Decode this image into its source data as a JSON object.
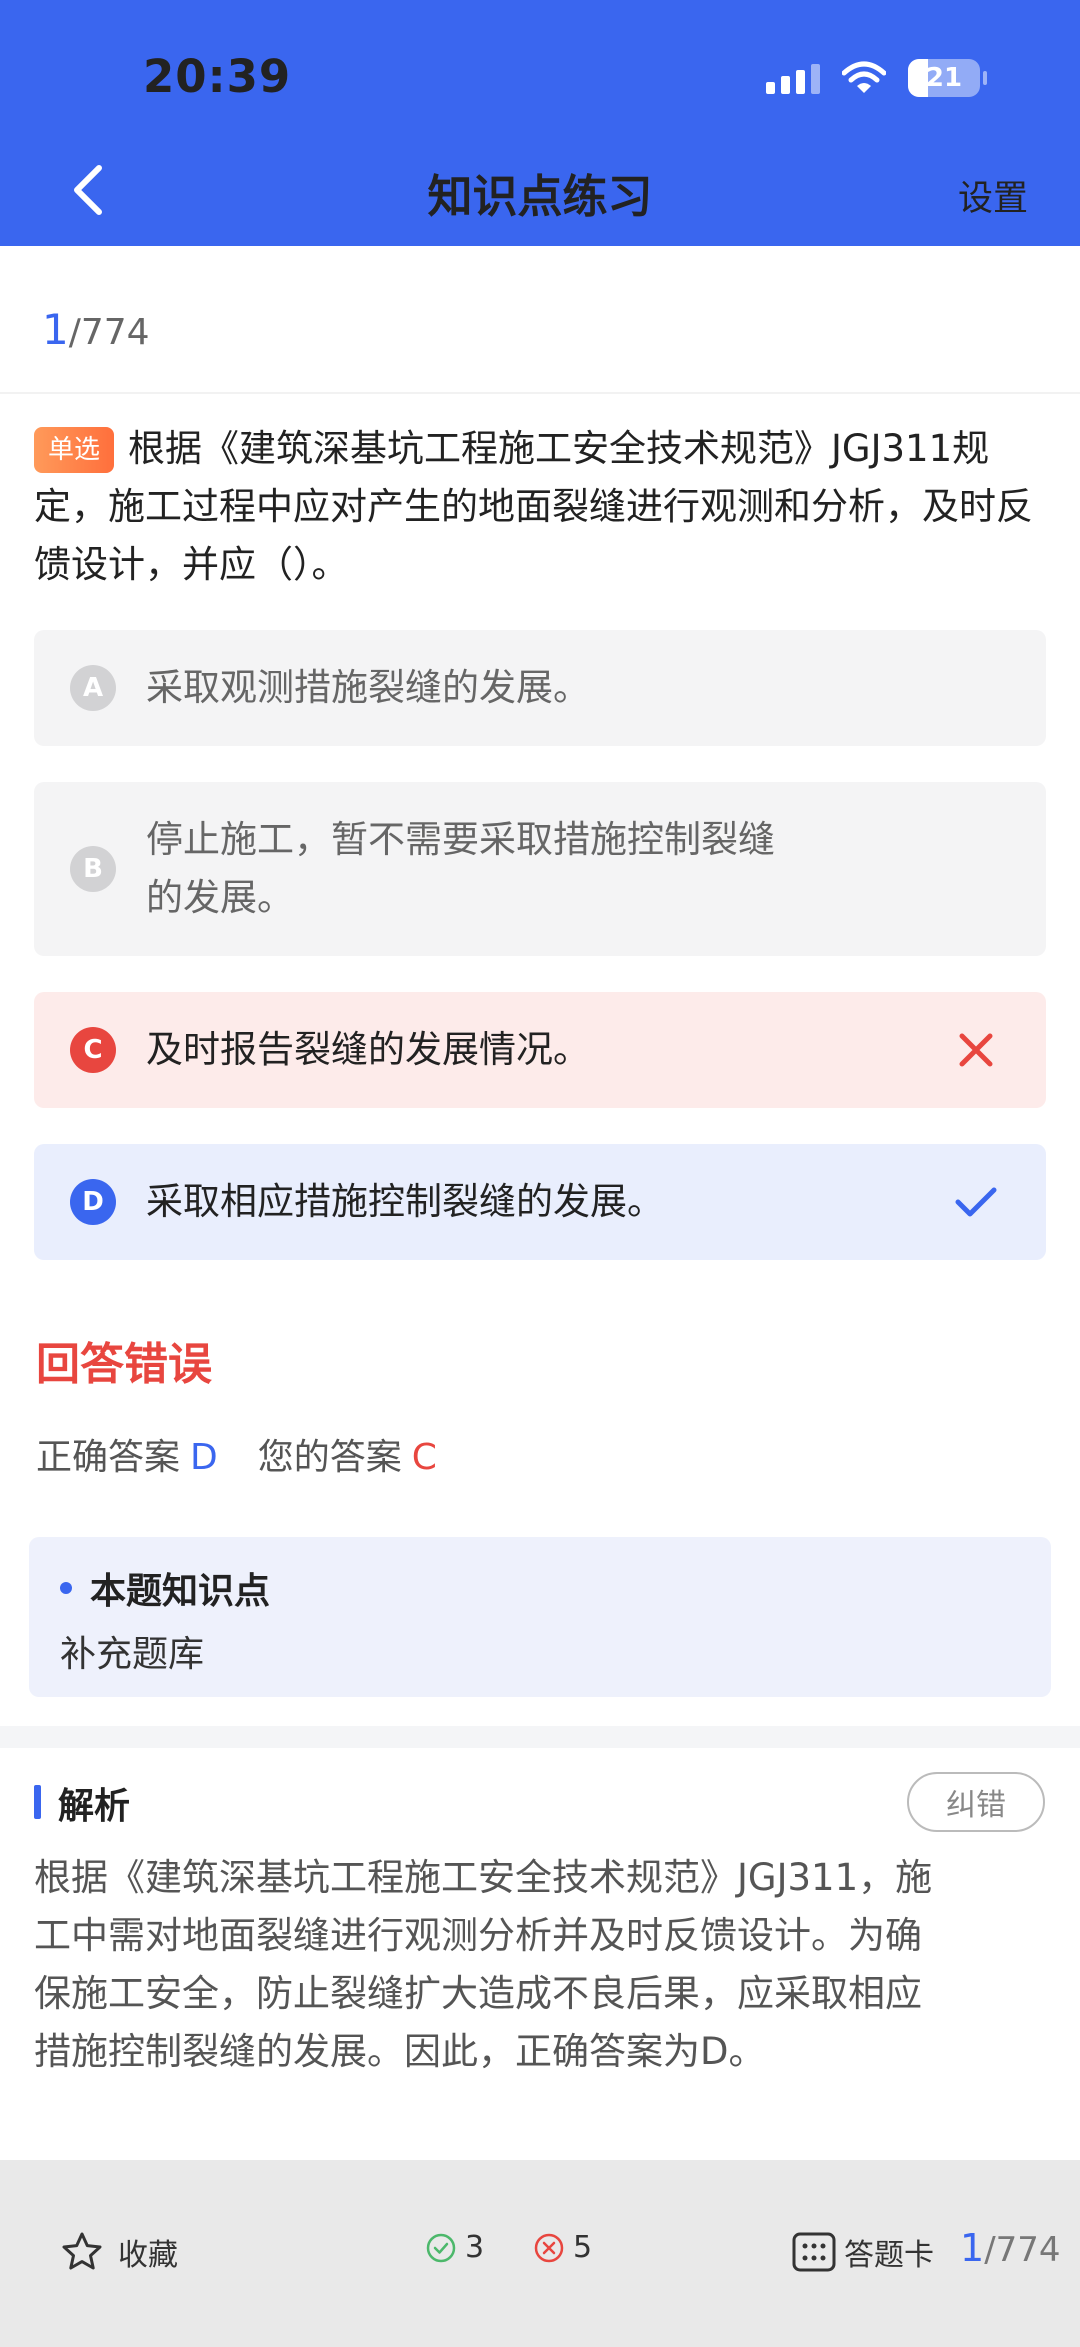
{
  "status_bar": {
    "time": "20:39",
    "battery": "21"
  },
  "nav": {
    "title": "知识点练习",
    "settings_label": "设置"
  },
  "progress": {
    "current": "1",
    "total": "/774"
  },
  "question": {
    "type_tag": "单选",
    "text": "根据《建筑深基坑工程施工安全技术规范》JGJ311规定，施工过程中应对产生的地面裂缝进行观测和分析，及时反馈设计，并应（）。"
  },
  "options": [
    {
      "letter": "A",
      "text": "采取观测措施裂缝的发展。",
      "state": "normal"
    },
    {
      "letter": "B",
      "line1": "停止施工，暂不需要采取措施控制裂缝",
      "line2": "的发展。",
      "state": "normal"
    },
    {
      "letter": "C",
      "text": "及时报告裂缝的发展情况。",
      "state": "wrong"
    },
    {
      "letter": "D",
      "text": "采取相应措施控制裂缝的发展。",
      "state": "correct"
    }
  ],
  "result": {
    "title": "回答错误",
    "correct_label": "正确答案",
    "correct_value": "D",
    "your_label": "您的答案",
    "your_value": "C"
  },
  "knowledge": {
    "title": "本题知识点",
    "content": "补充题库"
  },
  "analysis": {
    "title": "解析",
    "report_label": "纠错",
    "lines": [
      "根据《建筑深基坑工程施工安全技术规范》JGJ311，施",
      "工中需对地面裂缝进行观测分析并及时反馈设计。为确",
      "保施工安全，防止裂缝扩大造成不良后果，应采取相应",
      "措施控制裂缝的发展。因此，正确答案为D。"
    ]
  },
  "footer": {
    "favorite_label": "收藏",
    "correct_count": "3",
    "wrong_count": "5",
    "card_label": "答题卡",
    "page_current": "1",
    "page_total": "/774"
  },
  "colors": {
    "primary": "#3a66ef",
    "error": "#e8463f",
    "success": "#4cb86b",
    "tag_orange": "#ff7a45"
  }
}
